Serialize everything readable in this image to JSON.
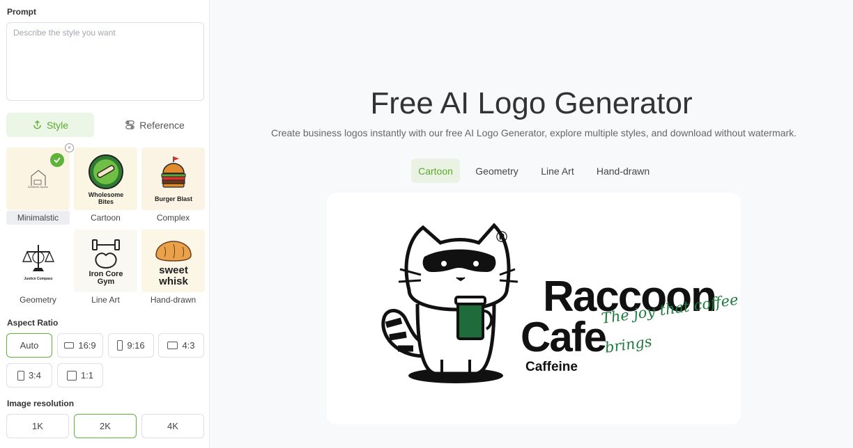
{
  "prompt": {
    "label": "Prompt",
    "placeholder": "Describe the style you want",
    "value": ""
  },
  "mode_tabs": {
    "style_label": "Style",
    "reference_label": "Reference"
  },
  "styles": [
    {
      "name": "Minimalstic",
      "thumb_text": "Aesthetic Space",
      "selected": true
    },
    {
      "name": "Cartoon",
      "thumb_text": "Wholesome Bites"
    },
    {
      "name": "Complex",
      "thumb_text": "Burger Blast"
    },
    {
      "name": "Geometry",
      "thumb_text": "Justice Compass"
    },
    {
      "name": "Line Art",
      "thumb_text_1": "Iron Core",
      "thumb_text_2": "Gym"
    },
    {
      "name": "Hand-drawn",
      "thumb_text_1": "sweet",
      "thumb_text_2": "whisk"
    }
  ],
  "aspect_ratio": {
    "label": "Aspect Ratio",
    "options": [
      "Auto",
      "16:9",
      "9:16",
      "4:3",
      "3:4",
      "1:1"
    ],
    "selected": "Auto"
  },
  "resolution": {
    "label": "Image resolution",
    "options": [
      "1K",
      "2K",
      "4K"
    ],
    "selected": "2K"
  },
  "main": {
    "title": "Free AI Logo Generator",
    "subtitle": "Create business logos instantly with our free AI Logo Generator, explore multiple styles, and download without watermark.",
    "tabs": [
      "Cartoon",
      "Geometry",
      "Line Art",
      "Hand-drawn"
    ],
    "active_tab": "Cartoon"
  },
  "preview_logo": {
    "line1": "Raccoon",
    "line2": "Cafe",
    "tagline_1": "The joy that coffee",
    "tagline_2": "brings",
    "sub": "Caffeine",
    "registered": "®"
  },
  "colors": {
    "accent": "#5fb33a",
    "accent_bg": "#ecf6e6",
    "cup_green": "#1f6b3a",
    "tagline_green": "#1f7a3e"
  }
}
